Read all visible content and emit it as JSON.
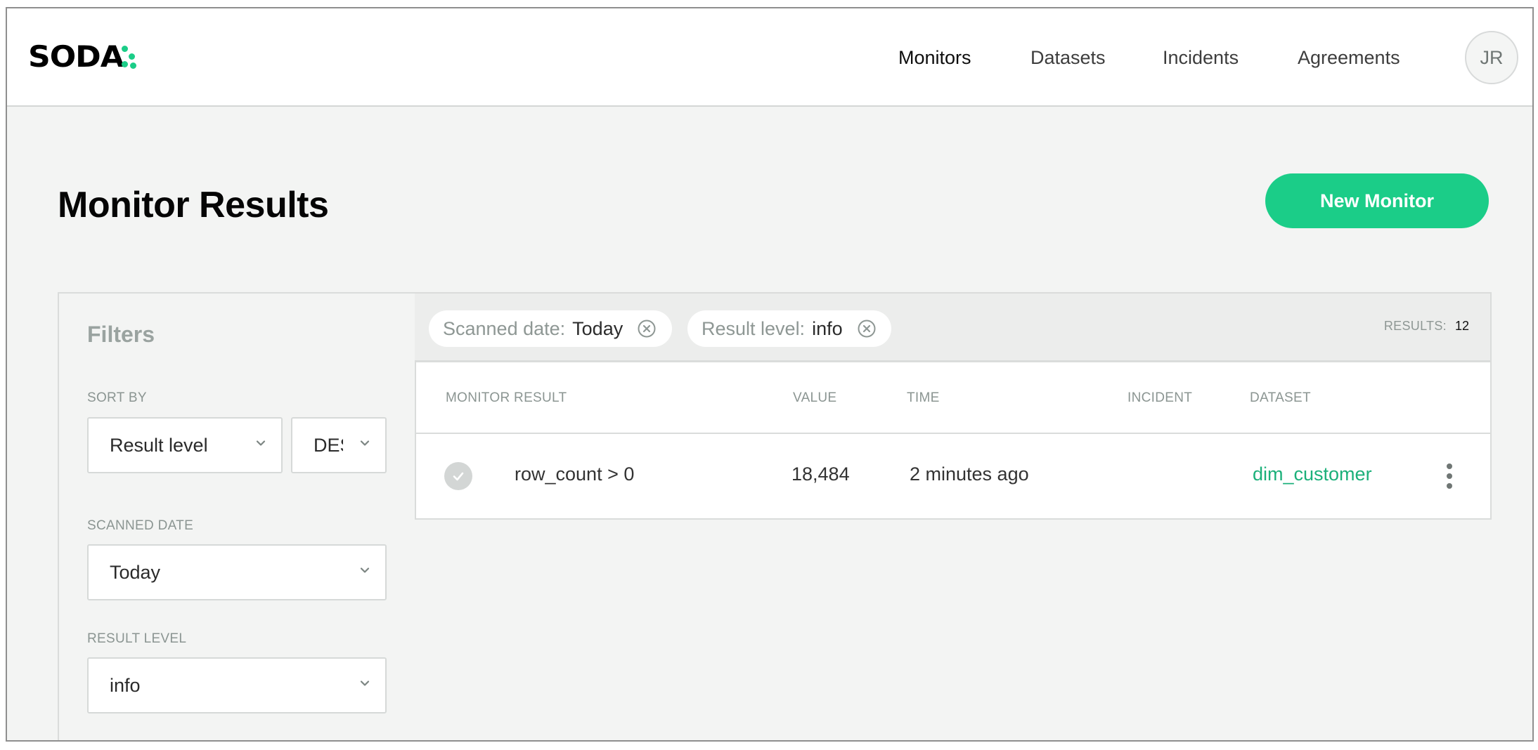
{
  "brand": {
    "name": "SODA",
    "accent": "#1bcd88"
  },
  "nav": {
    "items": [
      {
        "label": "Monitors",
        "active": true
      },
      {
        "label": "Datasets",
        "active": false
      },
      {
        "label": "Incidents",
        "active": false
      },
      {
        "label": "Agreements",
        "active": false
      }
    ],
    "user_initials": "JR"
  },
  "page": {
    "title": "Monitor Results",
    "new_button": "New Monitor"
  },
  "filters": {
    "title": "Filters",
    "sort_by_label": "SORT BY",
    "sort_field": "Result level",
    "sort_order": "DES",
    "scanned_date_label": "SCANNED DATE",
    "scanned_date_value": "Today",
    "result_level_label": "RESULT LEVEL",
    "result_level_value": "info"
  },
  "active_filters": [
    {
      "key": "Scanned date:",
      "value": "Today",
      "icon": "close-circle-icon"
    },
    {
      "key": "Result level:",
      "value": "info",
      "icon": "close-circle-icon"
    }
  ],
  "results_count": {
    "label": "RESULTS:",
    "value": "12"
  },
  "table": {
    "columns": [
      "MONITOR RESULT",
      "VALUE",
      "TIME",
      "INCIDENT",
      "DATASET"
    ],
    "rows": [
      {
        "status_icon": "check-circle-icon",
        "monitor_result": "row_count > 0",
        "value": "18,484",
        "time": "2 minutes ago",
        "incident": "",
        "dataset": "dim_customer"
      }
    ]
  }
}
